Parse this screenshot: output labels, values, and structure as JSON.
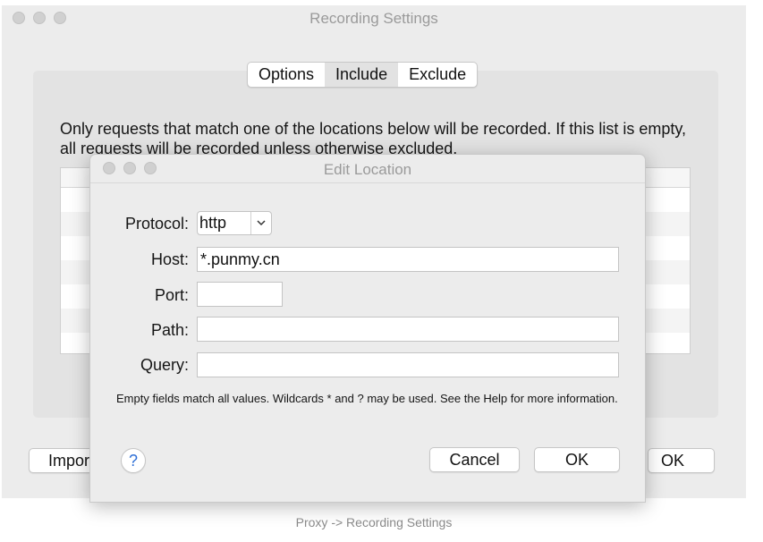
{
  "window": {
    "title": "Recording Settings"
  },
  "tabs": [
    {
      "label": "Options",
      "active": false
    },
    {
      "label": "Include",
      "active": true
    },
    {
      "label": "Exclude",
      "active": false
    }
  ],
  "include": {
    "description": "Only requests that match one of the locations below will be recorded. If this list is empty, all requests will be recorded unless otherwise excluded.",
    "import_label": "Import",
    "ok_label": "OK"
  },
  "dialog": {
    "title": "Edit Location",
    "fields": {
      "protocol": {
        "label": "Protocol:",
        "value": "http"
      },
      "host": {
        "label": "Host:",
        "value": "*.punmy.cn"
      },
      "port": {
        "label": "Port:",
        "value": ""
      },
      "path": {
        "label": "Path:",
        "value": ""
      },
      "query": {
        "label": "Query:",
        "value": ""
      }
    },
    "note": "Empty fields match all values. Wildcards * and ? may be used. See the Help for more information.",
    "help_label": "?",
    "cancel_label": "Cancel",
    "ok_label": "OK"
  },
  "caption": "Proxy -> Recording Settings",
  "colors": {
    "window_bg": "#ececec",
    "help_accent": "#2f6fd6",
    "title_text": "#9a9a9a"
  }
}
